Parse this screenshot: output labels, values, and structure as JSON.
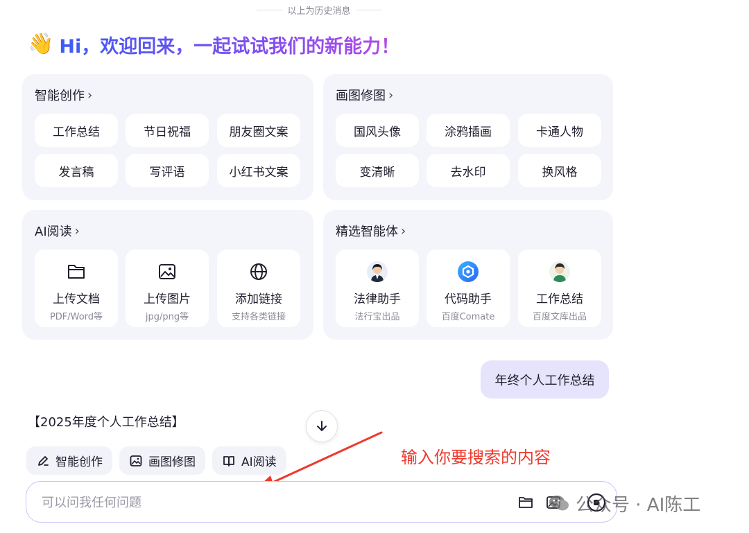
{
  "history_divider": "以上为历史消息",
  "greeting": {
    "emoji": "👋",
    "title": "Hi，欢迎回来，一起试试我们的新能力！"
  },
  "sections": {
    "writing": {
      "title": "智能创作",
      "chips": [
        "工作总结",
        "节日祝福",
        "朋友圈文案",
        "发言稿",
        "写评语",
        "小红书文案"
      ]
    },
    "drawing": {
      "title": "画图修图",
      "chips": [
        "国风头像",
        "涂鸦插画",
        "卡通人物",
        "变清晰",
        "去水印",
        "换风格"
      ]
    },
    "reading": {
      "title": "AI阅读",
      "cards": [
        {
          "icon": "folder-icon",
          "title": "上传文档",
          "subtitle": "PDF/Word等"
        },
        {
          "icon": "image-icon",
          "title": "上传图片",
          "subtitle": "jpg/png等"
        },
        {
          "icon": "globe-icon",
          "title": "添加链接",
          "subtitle": "支持各类链接"
        }
      ]
    },
    "agents": {
      "title": "精选智能体",
      "cards": [
        {
          "icon": "lawyer-avatar",
          "title": "法律助手",
          "subtitle": "法行宝出品"
        },
        {
          "icon": "comate-logo",
          "title": "代码助手",
          "subtitle": "百度Comate"
        },
        {
          "icon": "worker-avatar",
          "title": "工作总结",
          "subtitle": "百度文库出品"
        }
      ]
    }
  },
  "chevron": "›",
  "user_message": "年终个人工作总结",
  "assistant_reply": "【2025年度个人工作总结】",
  "tools": [
    {
      "icon": "pen-sparkle-icon",
      "label": "智能创作"
    },
    {
      "icon": "image-edit-icon",
      "label": "画图修图"
    },
    {
      "icon": "book-icon",
      "label": "AI阅读"
    }
  ],
  "annotation": "输入你要搜索的内容",
  "input": {
    "placeholder": "可以问我任何问题",
    "value": ""
  },
  "watermark": "公众号 · AI陈工",
  "colors": {
    "brand_gradient": [
      "#3d5cf5",
      "#7c4ff0",
      "#b44be8"
    ],
    "panel_bg": "#f4f5fb",
    "user_bubble": "#e6e3fd",
    "annotation": "#ee3a2e",
    "input_border": "#c7c2f5"
  }
}
